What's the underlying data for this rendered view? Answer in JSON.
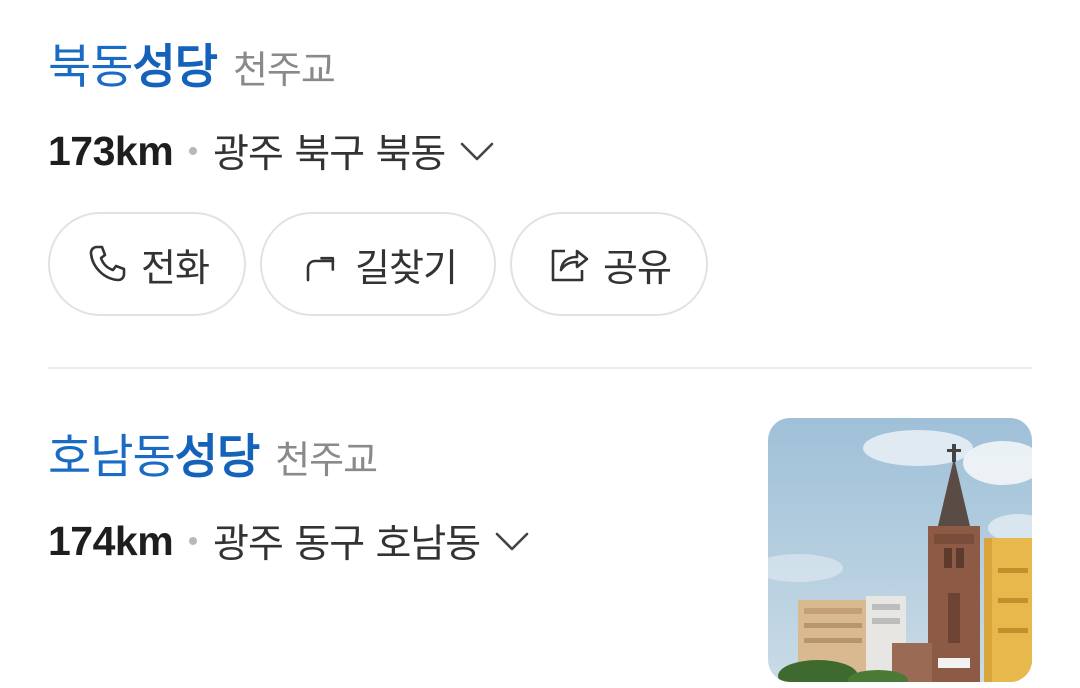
{
  "results": [
    {
      "name_prefix": "북동",
      "name_highlight": "성당",
      "category": "천주교",
      "distance": "173km",
      "address": "광주 북구 북동"
    },
    {
      "name_prefix": "호남동",
      "name_highlight": "성당",
      "category": "천주교",
      "distance": "174km",
      "address": "광주 동구 호남동"
    }
  ],
  "actions": {
    "call_label": "전화",
    "route_label": "길찾기",
    "share_label": "공유"
  },
  "icons": {
    "call": "phone-icon",
    "route": "directions-arrow-icon",
    "share": "share-icon",
    "expand": "chevron-down-icon"
  },
  "colors": {
    "title": "#1a6bc4",
    "highlight": "#1462ba",
    "category": "#8a8a8a"
  }
}
